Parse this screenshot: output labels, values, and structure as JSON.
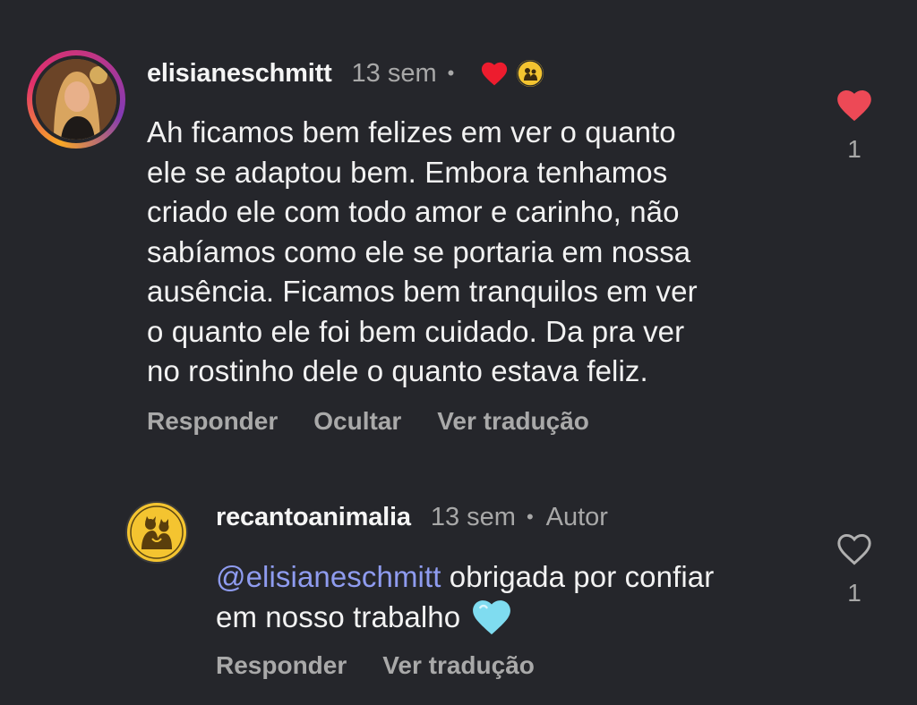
{
  "comments": [
    {
      "username": "elisianeschmitt",
      "time": "13 sem",
      "separator": "•",
      "text_lines": [
        "Ah ficamos bem felizes em ver o quanto",
        "ele se adaptou bem. Embora tenhamos",
        "criado ele com todo amor e carinho, não",
        "sabíamos como ele se portaria em nossa",
        "ausência. Ficamos bem tranquilos em ver",
        "o quanto ele foi bem cuidado. Da pra ver",
        "no rostinho dele o quanto estava feliz."
      ],
      "actions": [
        "Responder",
        "Ocultar",
        "Ver tradução"
      ],
      "like_count": "1",
      "liked": true,
      "author_liked_icon": "heart-icon",
      "author_badge_icon": "animal-logo-icon"
    },
    {
      "username": "recantoanimalia",
      "time": "13 sem",
      "separator": "•",
      "author_label": "Autor",
      "mention": "@elisianeschmitt",
      "text_after_mention": " obrigada por confiar",
      "text_line2": "em nosso trabalho ",
      "emoji": "light-blue-heart-icon",
      "actions": [
        "Responder",
        "Ver tradução"
      ],
      "like_count": "1",
      "liked": false
    }
  ],
  "colors": {
    "background": "#25262b",
    "like_red": "#ed4956",
    "mention_blue": "#8f9cf0",
    "badge_yellow": "#f4c430",
    "light_blue_heart": "#7fdcf0"
  }
}
